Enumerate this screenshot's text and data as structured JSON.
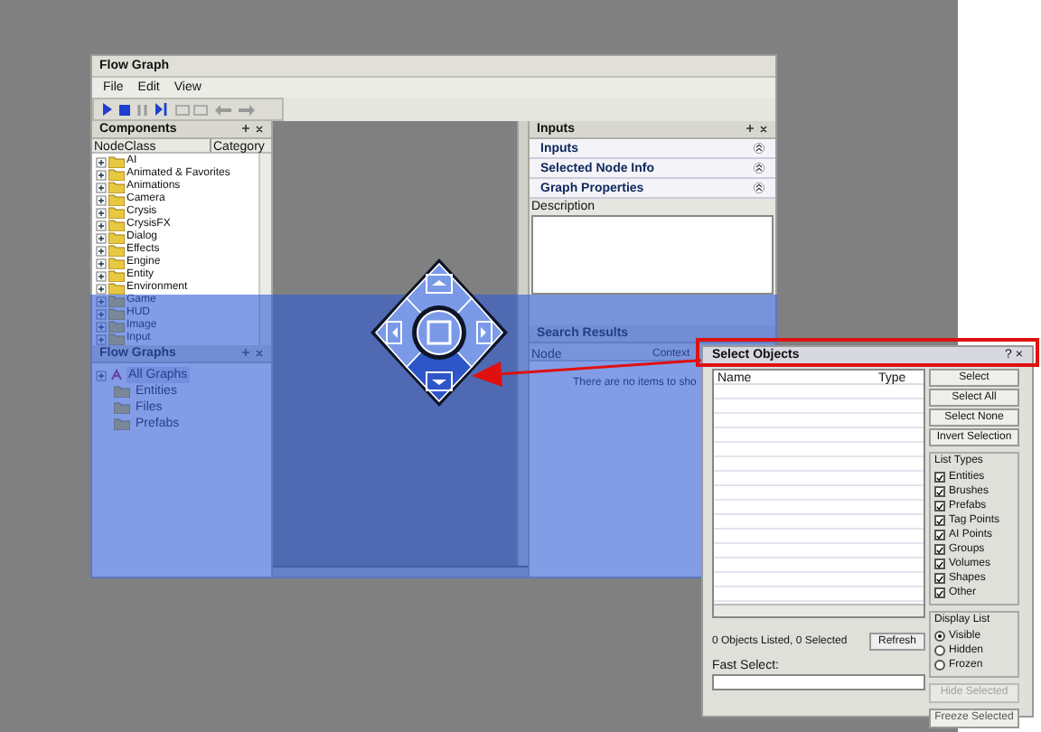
{
  "window": {
    "title": "Flow Graph"
  },
  "menu": [
    "File",
    "Edit",
    "View"
  ],
  "components": {
    "title": "Components",
    "columns": [
      "NodeClass",
      "Category"
    ],
    "items": [
      "AI",
      "Animated & Favorites",
      "Animations",
      "Camera",
      "Crysis",
      "CrysisFX",
      "Dialog",
      "Effects",
      "Engine",
      "Entity",
      "Environment",
      "Game",
      "HUD",
      "Image",
      "Input"
    ]
  },
  "flow_graphs": {
    "title": "Flow Graphs",
    "tree": [
      {
        "label": "All Graphs",
        "selected": true,
        "children": [
          {
            "label": "Entities",
            "selected": false
          },
          {
            "label": "Files",
            "selected": false
          },
          {
            "label": "Prefabs",
            "selected": false
          }
        ]
      }
    ]
  },
  "inputs": {
    "title": "Inputs",
    "sections": [
      "Inputs",
      "Selected Node Info",
      "Graph Properties"
    ],
    "description_label": "Description"
  },
  "search_results": {
    "title": "Search Results",
    "columns": [
      "Node",
      "Context"
    ],
    "empty_text": "There are no items to sho"
  },
  "select_objects": {
    "title": "Select Objects",
    "help": "?",
    "close": "×",
    "columns": [
      "Name",
      "Type"
    ],
    "buttons": [
      "Select",
      "Select All",
      "Select None",
      "Invert Selection"
    ],
    "list_types": {
      "title": "List Types",
      "items": [
        {
          "label": "Entities",
          "checked": true
        },
        {
          "label": "Brushes",
          "checked": true
        },
        {
          "label": "Prefabs",
          "checked": true
        },
        {
          "label": "Tag Points",
          "checked": true
        },
        {
          "label": "AI Points",
          "checked": true
        },
        {
          "label": "Groups",
          "checked": true
        },
        {
          "label": "Volumes",
          "checked": true
        },
        {
          "label": "Shapes",
          "checked": true
        },
        {
          "label": "Other",
          "checked": true
        }
      ]
    },
    "display_list": {
      "title": "Display List",
      "options": [
        {
          "label": "Visible",
          "selected": true
        },
        {
          "label": "Hidden",
          "selected": false
        },
        {
          "label": "Frozen",
          "selected": false
        }
      ]
    },
    "status": "0 Objects Listed, 0 Selected",
    "refresh": "Refresh",
    "fast_select_label": "Fast Select:",
    "actions": [
      {
        "label": "Hide Selected",
        "disabled": true
      },
      {
        "label": "Freeze Selected",
        "disabled": false
      }
    ]
  }
}
